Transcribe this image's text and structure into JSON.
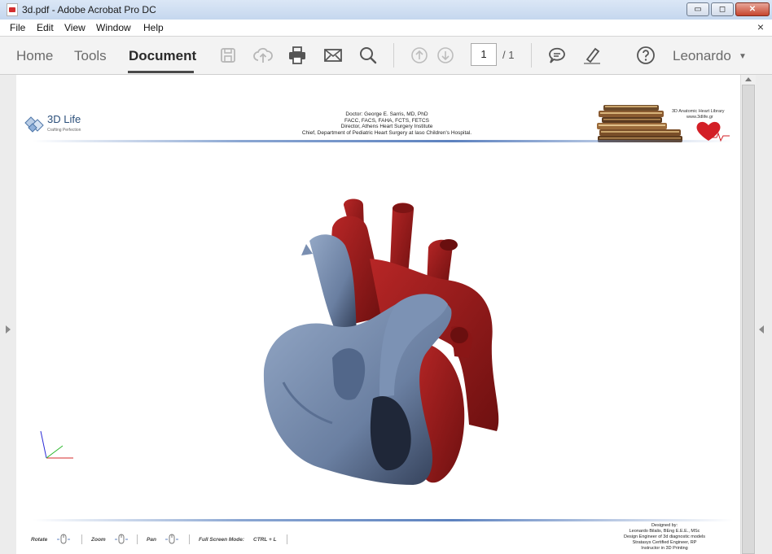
{
  "window": {
    "title": "3d.pdf - Adobe Acrobat Pro DC",
    "minimize_glyph": "▭",
    "maximize_glyph": "◻",
    "close_glyph": "✕"
  },
  "menu": {
    "items": [
      "File",
      "Edit",
      "View",
      "Window",
      "Help"
    ],
    "close_glyph": "×"
  },
  "toolbar": {
    "tabs": [
      "Home",
      "Tools",
      "Document"
    ],
    "active_tab": "Document",
    "page_current": "1",
    "page_total": "/ 1",
    "user": "Leonardo",
    "user_caret": "▼",
    "icons": [
      "save-icon",
      "upload-icon",
      "print-icon",
      "mail-icon",
      "search-icon",
      "page-up-icon",
      "page-down-icon",
      "comment-icon",
      "highlight-icon",
      "help-icon"
    ]
  },
  "document": {
    "logo": {
      "name": "3D Life",
      "tagline": "Crafting Perfection"
    },
    "doctor_lines": [
      "Doctor: George E. Sarris, MD, PhD",
      "FACC, FACS, FAHA, FCTS, FETCS",
      "Director, Athens Heart Surgery Institute",
      "Chief, Department of Pediatric Heart Surgery at Iaso Children's Hospital."
    ],
    "library_title": "3D Anatomic Heart Library",
    "library_url": "www.3dlife.gr",
    "colors": {
      "aorta_red": "#9b1c1c",
      "ventricle_blue": "#6f86a8",
      "accent": "#5d82bf"
    },
    "controls": {
      "rotate": "Rotate",
      "zoom": "Zoom",
      "pan": "Pan",
      "fullscreen": "Full Screen Mode:",
      "fullscreen_keys": "CTRL + L"
    },
    "designer_lines": [
      "Designed by:",
      "Leonardo Bilalis, BEng E.E.E., MSc",
      "Design Engineer of 3d diagnostic models",
      "Stratasys Certified Engineer, RP",
      "Instructor in 3D Printing"
    ]
  }
}
